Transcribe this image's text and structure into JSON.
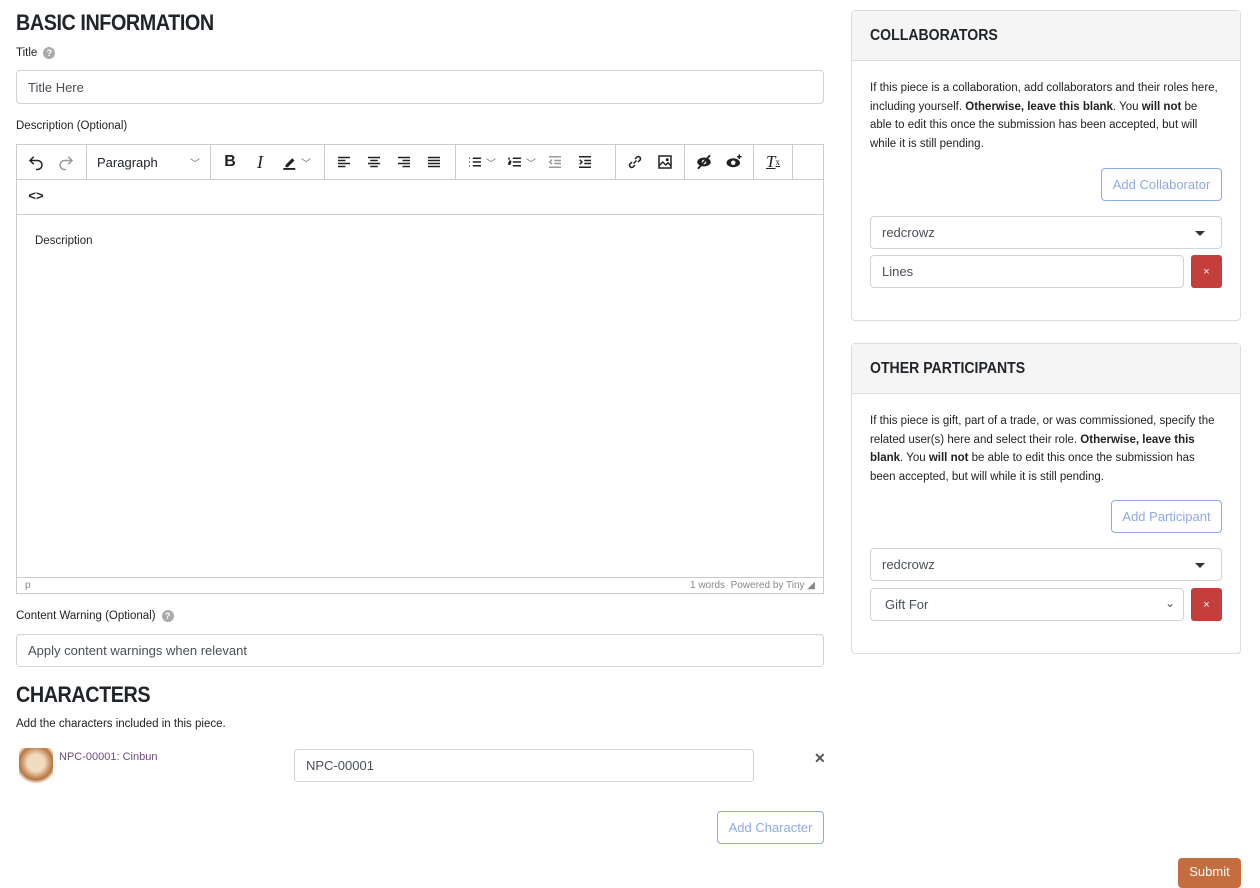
{
  "basic": {
    "heading": "BASIC INFORMATION",
    "title_label": "Title",
    "title_value": "Title Here",
    "description_label": "Description (Optional)",
    "editor": {
      "format_select": "Paragraph",
      "content": "Description",
      "status_path": "p",
      "word_count": "1 words",
      "powered_by": "Powered by Tiny",
      "tools": [
        "undo-icon",
        "redo-icon",
        "bold-icon",
        "italic-icon",
        "highlight-icon",
        "align-left-icon",
        "align-center-icon",
        "align-right-icon",
        "align-justify-icon",
        "bullet-list-icon",
        "numbered-list-icon",
        "outdent-icon",
        "indent-icon",
        "link-icon",
        "image-icon",
        "eye-slash-icon",
        "eye-plus-icon",
        "clear-format-icon",
        "code-icon"
      ]
    },
    "cw_label": "Content Warning (Optional)",
    "cw_value": "Apply content warnings when relevant"
  },
  "characters": {
    "heading": "CHARACTERS",
    "hint": "Add the characters included in this piece.",
    "items": [
      {
        "name": "NPC-00001: Cinbun",
        "code": "NPC-00001"
      }
    ],
    "add_label": "Add Character"
  },
  "collaborators": {
    "heading": "COLLABORATORS",
    "text_parts": [
      "If this piece is a collaboration, add collaborators and their roles here, including yourself. ",
      "Otherwise, leave this blank",
      ". You ",
      "will not",
      " be able to edit this once the submission has been accepted, but will while it is still pending."
    ],
    "add_label": "Add Collaborator",
    "user": "redcrowz",
    "role": "Lines",
    "remove": "×"
  },
  "participants": {
    "heading": "OTHER PARTICIPANTS",
    "text_parts": [
      "If this piece is gift, part of a trade, or was commissioned, specify the related user(s) here and select their role. ",
      "Otherwise, leave this blank",
      ". You ",
      "will not",
      " be able to edit this once the submission has been accepted, but will while it is still pending."
    ],
    "add_label": "Add Participant",
    "user": "redcrowz",
    "role": "Gift For",
    "remove": "×"
  },
  "submit_label": "Submit",
  "colors": {
    "accent": "#8fa9e6",
    "danger": "#c43e3b",
    "submit": "#c46d3f"
  }
}
